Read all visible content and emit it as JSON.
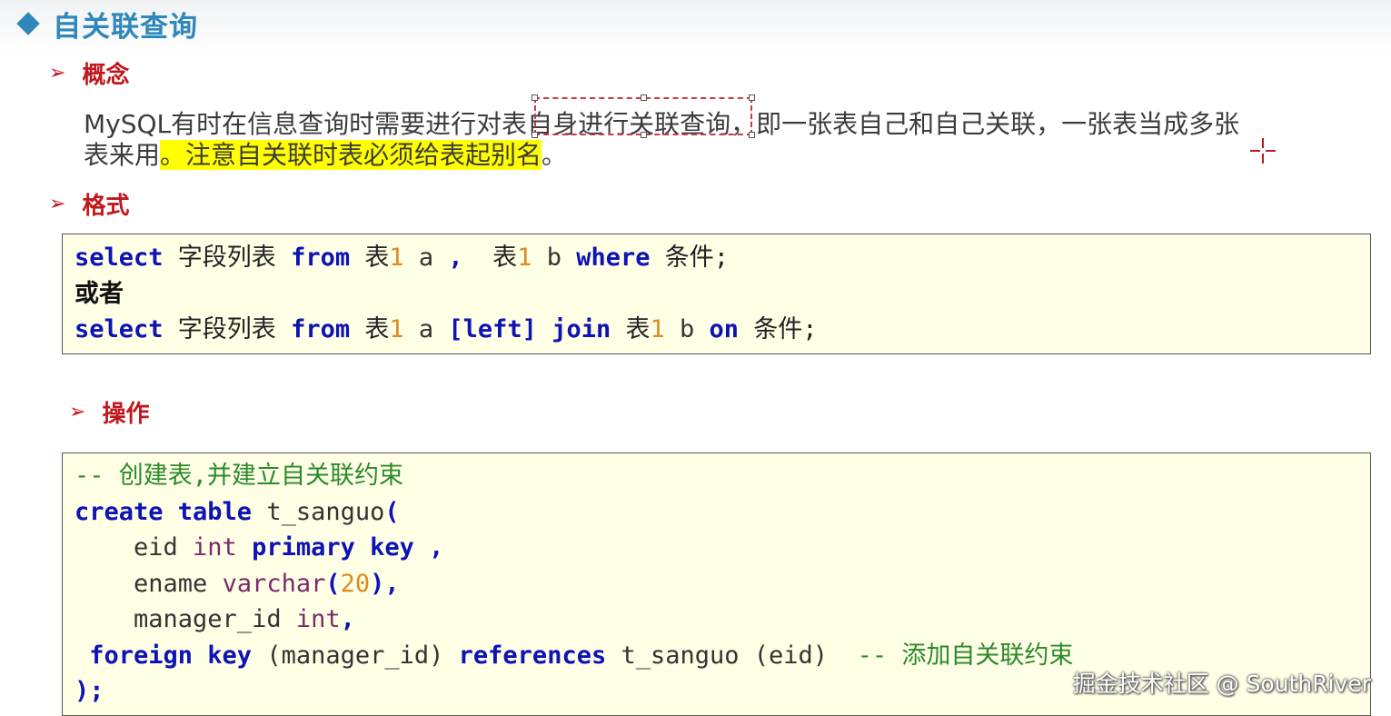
{
  "slide": {
    "title": "自关联查询",
    "sections": {
      "concept": "概念",
      "format": "格式",
      "operation": "操作"
    },
    "concept_text": {
      "part1": "MySQL有时在信息查询时需要进行对表",
      "part2_selected": "自身进行关联查询",
      "part3": "，即一张表自己和自己关联，一张表当成多张表来用",
      "highlight": "。注意自关联时表必须给表起别名",
      "end": "。"
    }
  },
  "format_code": {
    "select": "select",
    "fields": " 字段列表 ",
    "from": "from",
    "table": " 表",
    "one": "1",
    "alias_a": " a ",
    "comma": ", ",
    "alias_b": " b ",
    "where": "where",
    "condition": " 条件;",
    "or": "或者",
    "left_join": "[left] join",
    "on": "on"
  },
  "operation_code": {
    "comment1": "-- 创建表,并建立自关联约束",
    "create_table": "create table",
    "table_name": " t_sanguo",
    "open_paren": "(",
    "eid": "    eid ",
    "int": "int",
    "primary_key": "primary key",
    "comma_sp": " ,",
    "ename": "    ename ",
    "varchar": "varchar",
    "len": "20",
    "paren_comma": "),",
    "manager_id": "    manager_id ",
    "comma": ",",
    "foreign_key": " foreign key",
    "fk_col": " (manager_id) ",
    "references": "references",
    "ref_table": " t_sanguo (eid)  ",
    "comment2": "-- 添加自关联约束",
    "close": ");"
  },
  "watermark": "掘金技术社区 @ SouthRiver",
  "colors": {
    "title": "#2e88b9",
    "section": "#c0181c",
    "keyword": "#0d13b4",
    "number": "#e08a1e",
    "comment": "#2b8a2b",
    "highlight": "#ffff00",
    "code_bg": "#ffffe6"
  }
}
